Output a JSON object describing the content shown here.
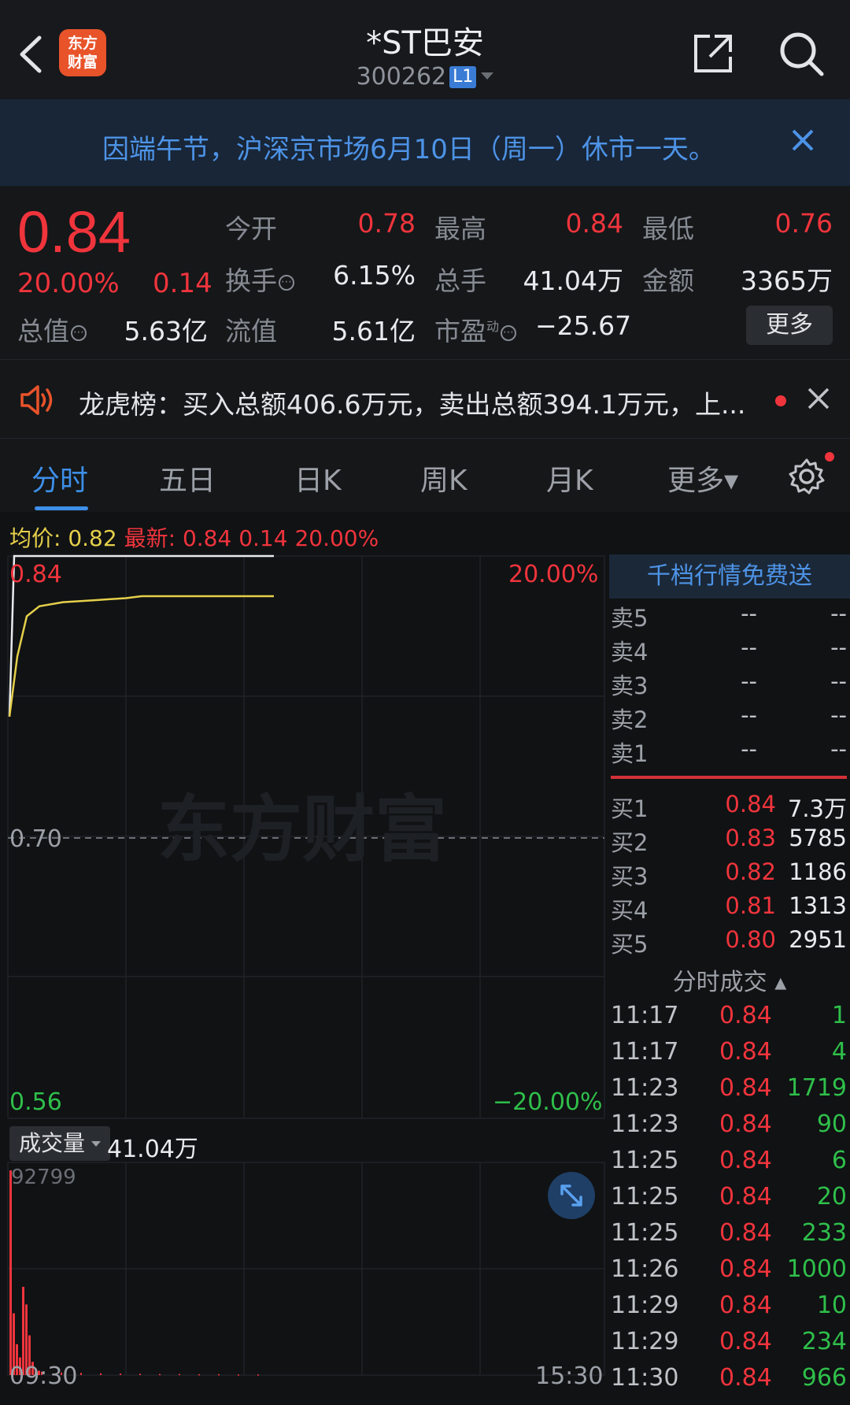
{
  "header": {
    "title": "*ST巴安",
    "code": "300262",
    "level_badge": "L1",
    "logo_text_1": "东方",
    "logo_text_2": "财富"
  },
  "notice": {
    "text": "因端午节，沪深京市场6月10日（周一）休市一天。"
  },
  "quote": {
    "price": "0.84",
    "change_pct": "20.00%",
    "change": "0.14",
    "open_label": "今开",
    "open": "0.78",
    "high_label": "最高",
    "high": "0.84",
    "low_label": "最低",
    "low": "0.76",
    "turnover_label": "换手",
    "turnover": "6.15%",
    "volume_label": "总手",
    "volume": "41.04万",
    "amount_label": "金额",
    "amount": "3365万",
    "mktcap_label": "总值",
    "mktcap": "5.63亿",
    "float_label": "流值",
    "float_cap": "5.61亿",
    "pe_label": "市盈",
    "pe_sup": "动",
    "pe": "−25.67",
    "more_label": "更多"
  },
  "dragon_tiger": {
    "text": "龙虎榜：买入总额406.6万元，卖出总额394.1万元，上..."
  },
  "tabs": [
    {
      "label": "分时"
    },
    {
      "label": "五日"
    },
    {
      "label": "日K"
    },
    {
      "label": "周K"
    },
    {
      "label": "月K"
    },
    {
      "label": "更多▾"
    }
  ],
  "legend": {
    "avg_label": "均价:",
    "avg": "0.82",
    "latest_label": "最新:",
    "latest": "0.84",
    "change": "0.14",
    "change_pct": "20.00%"
  },
  "chart_axis": {
    "top_price": "0.84",
    "top_pct": "20.00%",
    "mid_price": "0.70",
    "bottom_price": "0.56",
    "bottom_pct": "−20.00%",
    "watermark": "东方财富",
    "time_start": "09:30",
    "time_end": "15:30"
  },
  "chart_data": {
    "type": "line",
    "ylim": [
      0.56,
      0.84
    ],
    "series": [
      {
        "values": [
          0.76,
          0.84,
          0.84,
          0.84,
          0.84,
          0.84
        ]
      },
      {
        "values": [
          0.76,
          0.79,
          0.81,
          0.815,
          0.817,
          0.818,
          0.819,
          0.82,
          0.82,
          0.82,
          0.82
        ]
      }
    ],
    "volume_max": "92799",
    "volume": [
      92799,
      28000,
      14000,
      8000,
      40000,
      32000,
      18000,
      6000,
      3000,
      2000,
      1500,
      1200,
      1000,
      800,
      700,
      600,
      500,
      500,
      400,
      400,
      300,
      300
    ]
  },
  "volume": {
    "tag_label": "成交量",
    "total": "41.04万"
  },
  "order_book": {
    "header": "千档行情免费送",
    "asks": [
      {
        "label": "卖5",
        "price": "--",
        "qty": "--"
      },
      {
        "label": "卖4",
        "price": "--",
        "qty": "--"
      },
      {
        "label": "卖3",
        "price": "--",
        "qty": "--"
      },
      {
        "label": "卖2",
        "price": "--",
        "qty": "--"
      },
      {
        "label": "卖1",
        "price": "--",
        "qty": "--"
      }
    ],
    "bids": [
      {
        "label": "买1",
        "price": "0.84",
        "qty": "7.3万"
      },
      {
        "label": "买2",
        "price": "0.83",
        "qty": "5785"
      },
      {
        "label": "买3",
        "price": "0.82",
        "qty": "1186"
      },
      {
        "label": "买4",
        "price": "0.81",
        "qty": "1313"
      },
      {
        "label": "买5",
        "price": "0.80",
        "qty": "2951"
      }
    ]
  },
  "trades": {
    "header": "分时成交 ▴",
    "rows": [
      {
        "time": "11:17",
        "price": "0.84",
        "qty": "1"
      },
      {
        "time": "11:17",
        "price": "0.84",
        "qty": "4"
      },
      {
        "time": "11:23",
        "price": "0.84",
        "qty": "1719"
      },
      {
        "time": "11:23",
        "price": "0.84",
        "qty": "90"
      },
      {
        "time": "11:25",
        "price": "0.84",
        "qty": "6"
      },
      {
        "time": "11:25",
        "price": "0.84",
        "qty": "20"
      },
      {
        "time": "11:25",
        "price": "0.84",
        "qty": "233"
      },
      {
        "time": "11:26",
        "price": "0.84",
        "qty": "1000"
      },
      {
        "time": "11:29",
        "price": "0.84",
        "qty": "10"
      },
      {
        "time": "11:29",
        "price": "0.84",
        "qty": "234"
      },
      {
        "time": "11:30",
        "price": "0.84",
        "qty": "966"
      }
    ]
  },
  "colors": {
    "up": "#f0343c",
    "down": "#2fbf4a",
    "accent": "#3d8fe8",
    "avg_line": "#e5cf4a"
  }
}
